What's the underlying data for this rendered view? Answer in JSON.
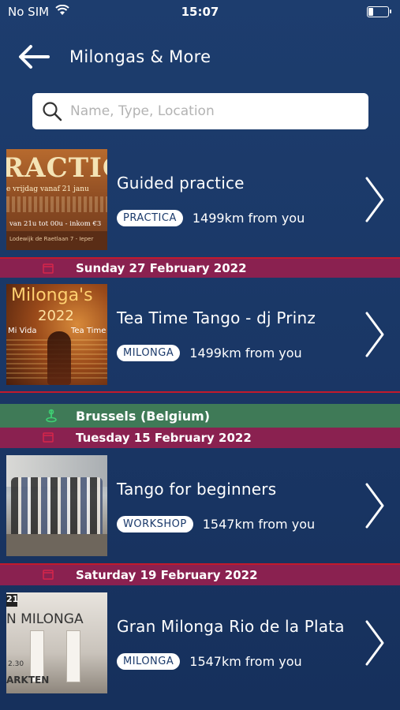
{
  "status": {
    "carrier": "No SIM",
    "time": "15:07"
  },
  "header": {
    "title": "Milongas & More"
  },
  "search": {
    "placeholder": "Name, Type, Location"
  },
  "colors": {
    "date_band": "#8a2150",
    "city_band": "#3f7a57",
    "divider": "#c21a2c"
  },
  "sections": [
    {
      "event": {
        "title": "Guided practice",
        "type": "PRACTICA",
        "distance": "1499km from you",
        "thumb_text": {
          "main": "RACTIC",
          "line1": "e vrijdag vanaf 21 janu",
          "line2": "van 21u tot 00u - inkom €3",
          "line3": "Lodewijk de Raetlaan 7 - Ieper"
        }
      }
    },
    {
      "date": "Sunday 27 February 2022",
      "event": {
        "title": "Tea Time Tango - dj Prinz",
        "type": "MILONGA",
        "distance": "1499km from you",
        "thumb_text": {
          "main": "Milonga's",
          "year": "2022",
          "left": "Mi Vida",
          "right": "Tea Time"
        }
      }
    },
    {
      "city": "Brussels (Belgium)",
      "date": "Tuesday 15 February 2022",
      "event": {
        "title": "Tango for beginners",
        "type": "WORKSHOP",
        "distance": "1547km from you"
      }
    },
    {
      "date": "Saturday 19 February 2022",
      "event": {
        "title": "Gran Milonga Rio de la Plata",
        "type": "MILONGA",
        "distance": "1547km from you",
        "thumb_text": {
          "num": "21",
          "main": "N MILONGA",
          "time": "2.30",
          "bottom": "ARKTEN"
        }
      }
    }
  ]
}
